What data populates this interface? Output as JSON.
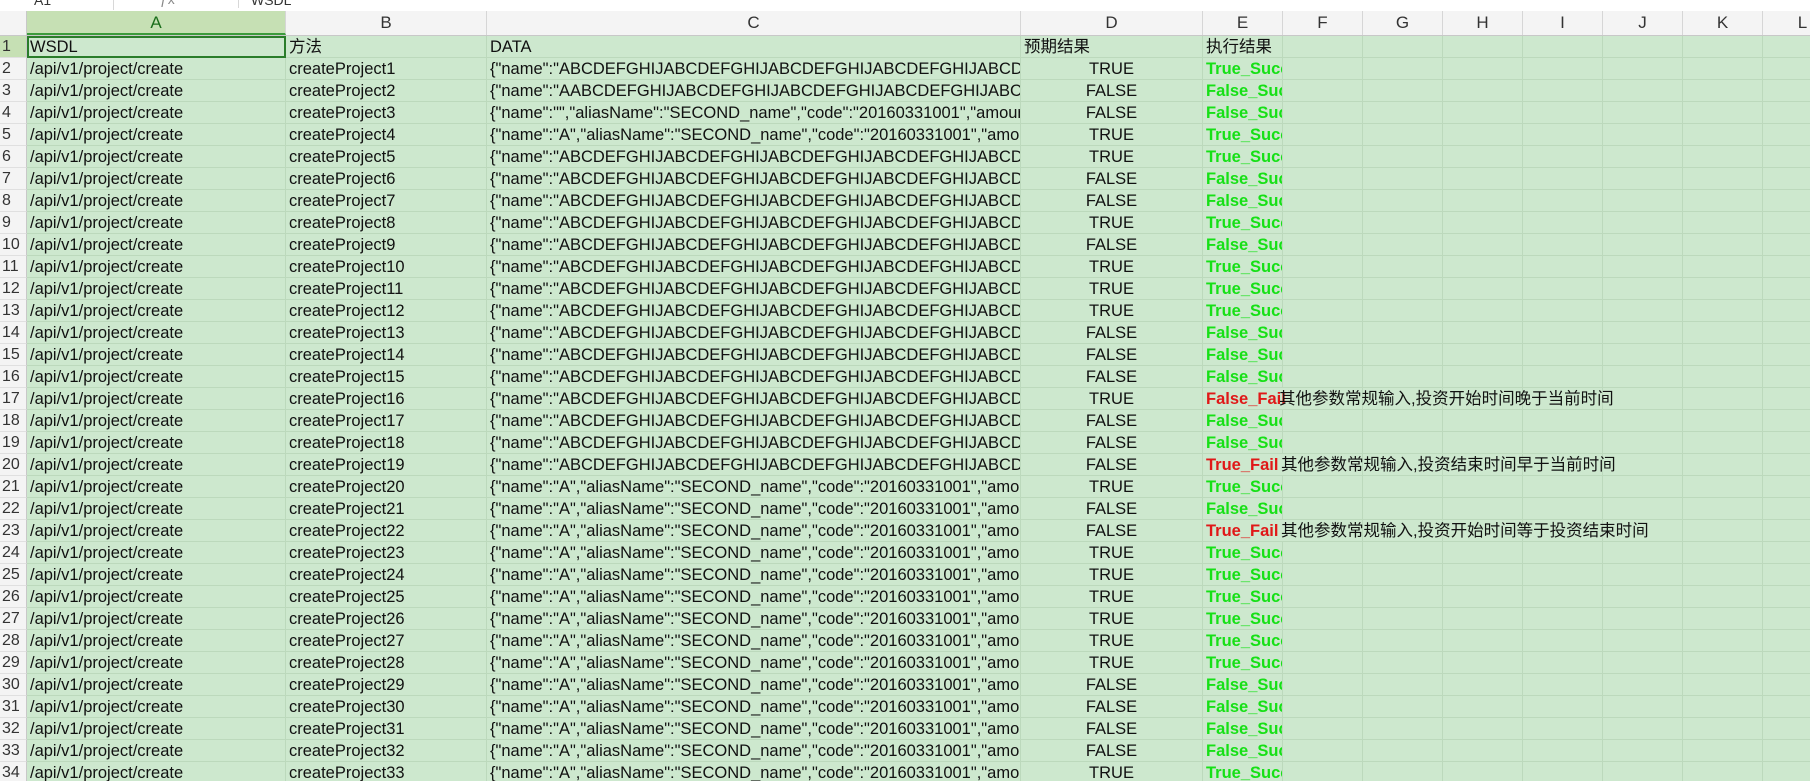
{
  "formula_bar": {
    "name_box": "A1",
    "formula": "WSDL"
  },
  "columns": [
    "A",
    "B",
    "C",
    "D",
    "E",
    "F",
    "G",
    "H",
    "I",
    "J",
    "K",
    "L"
  ],
  "selected_column": "A",
  "rows": [
    {
      "n": "1",
      "a": "WSDL",
      "b": "方法",
      "c": "DATA",
      "d": "预期结果",
      "e": "执行结果",
      "status": "header",
      "note": ""
    },
    {
      "n": "2",
      "a": "/api/v1/project/create",
      "b": "createProject1",
      "c": "{\"name\":\"ABCDEFGHIJABCDEFGHIJABCDEFGHIJABCDEFGHIJABCD",
      "d": "TRUE",
      "e": "True_Success",
      "status": "success",
      "note": ""
    },
    {
      "n": "3",
      "a": "/api/v1/project/create",
      "b": "createProject2",
      "c": "{\"name\":\"AABCDEFGHIJABCDEFGHIJABCDEFGHIJABCDEFGHIJABC",
      "d": "FALSE",
      "e": "False_Success",
      "status": "success",
      "note": ""
    },
    {
      "n": "4",
      "a": "/api/v1/project/create",
      "b": "createProject3",
      "c": "{\"name\":\"\",\"aliasName\":\"SECOND_name\",\"code\":\"20160331001\",\"amoun",
      "d": "FALSE",
      "e": "False_Success",
      "status": "success",
      "note": ""
    },
    {
      "n": "5",
      "a": "/api/v1/project/create",
      "b": "createProject4",
      "c": "{\"name\":\"A\",\"aliasName\":\"SECOND_name\",\"code\":\"20160331001\",\"amou",
      "d": "TRUE",
      "e": "True_Success",
      "status": "success",
      "note": ""
    },
    {
      "n": "6",
      "a": "/api/v1/project/create",
      "b": "createProject5",
      "c": "{\"name\":\"ABCDEFGHIJABCDEFGHIJABCDEFGHIJABCDEFGHIJABCD",
      "d": "TRUE",
      "e": "True_Success",
      "status": "success",
      "note": ""
    },
    {
      "n": "7",
      "a": "/api/v1/project/create",
      "b": "createProject6",
      "c": "{\"name\":\"ABCDEFGHIJABCDEFGHIJABCDEFGHIJABCDEFGHIJABCD",
      "d": "FALSE",
      "e": "False_Success",
      "status": "success",
      "note": ""
    },
    {
      "n": "8",
      "a": "/api/v1/project/create",
      "b": "createProject7",
      "c": "{\"name\":\"ABCDEFGHIJABCDEFGHIJABCDEFGHIJABCDEFGHIJABCD",
      "d": "FALSE",
      "e": "False_Success",
      "status": "success",
      "note": ""
    },
    {
      "n": "9",
      "a": "/api/v1/project/create",
      "b": "createProject8",
      "c": "{\"name\":\"ABCDEFGHIJABCDEFGHIJABCDEFGHIJABCDEFGHIJABCD",
      "d": "TRUE",
      "e": "True_Success",
      "status": "success",
      "note": ""
    },
    {
      "n": "10",
      "a": "/api/v1/project/create",
      "b": "createProject9",
      "c": "{\"name\":\"ABCDEFGHIJABCDEFGHIJABCDEFGHIJABCDEFGHIJABCD",
      "d": "FALSE",
      "e": "False_Success",
      "status": "success",
      "note": ""
    },
    {
      "n": "11",
      "a": "/api/v1/project/create",
      "b": "createProject10",
      "c": "{\"name\":\"ABCDEFGHIJABCDEFGHIJABCDEFGHIJABCDEFGHIJABCD",
      "d": "TRUE",
      "e": "True_Success",
      "status": "success",
      "note": ""
    },
    {
      "n": "12",
      "a": "/api/v1/project/create",
      "b": "createProject11",
      "c": "{\"name\":\"ABCDEFGHIJABCDEFGHIJABCDEFGHIJABCDEFGHIJABCD",
      "d": "TRUE",
      "e": "True_Success",
      "status": "success",
      "note": ""
    },
    {
      "n": "13",
      "a": "/api/v1/project/create",
      "b": "createProject12",
      "c": "{\"name\":\"ABCDEFGHIJABCDEFGHIJABCDEFGHIJABCDEFGHIJABCD",
      "d": "TRUE",
      "e": "True_Success",
      "status": "success",
      "note": ""
    },
    {
      "n": "14",
      "a": "/api/v1/project/create",
      "b": "createProject13",
      "c": "{\"name\":\"ABCDEFGHIJABCDEFGHIJABCDEFGHIJABCDEFGHIJABCD",
      "d": "FALSE",
      "e": "False_Success",
      "status": "success",
      "note": ""
    },
    {
      "n": "15",
      "a": "/api/v1/project/create",
      "b": "createProject14",
      "c": "{\"name\":\"ABCDEFGHIJABCDEFGHIJABCDEFGHIJABCDEFGHIJABCD",
      "d": "FALSE",
      "e": "False_Success",
      "status": "success",
      "note": ""
    },
    {
      "n": "16",
      "a": "/api/v1/project/create",
      "b": "createProject15",
      "c": "{\"name\":\"ABCDEFGHIJABCDEFGHIJABCDEFGHIJABCDEFGHIJABCD",
      "d": "FALSE",
      "e": "False_Success",
      "status": "success",
      "note": ""
    },
    {
      "n": "17",
      "a": "/api/v1/project/create",
      "b": "createProject16",
      "c": "{\"name\":\"ABCDEFGHIJABCDEFGHIJABCDEFGHIJABCDEFGHIJABCD",
      "d": "TRUE",
      "e": "False_Fail",
      "status": "fail",
      "note": "其他参数常规输入,投资开始时间晚于当前时间"
    },
    {
      "n": "18",
      "a": "/api/v1/project/create",
      "b": "createProject17",
      "c": "{\"name\":\"ABCDEFGHIJABCDEFGHIJABCDEFGHIJABCDEFGHIJABCD",
      "d": "FALSE",
      "e": "False_Success",
      "status": "success",
      "note": ""
    },
    {
      "n": "19",
      "a": "/api/v1/project/create",
      "b": "createProject18",
      "c": "{\"name\":\"ABCDEFGHIJABCDEFGHIJABCDEFGHIJABCDEFGHIJABCD",
      "d": "FALSE",
      "e": "False_Success",
      "status": "success",
      "note": ""
    },
    {
      "n": "20",
      "a": "/api/v1/project/create",
      "b": "createProject19",
      "c": "{\"name\":\"ABCDEFGHIJABCDEFGHIJABCDEFGHIJABCDEFGHIJABCD",
      "d": "FALSE",
      "e": "True_Fail",
      "status": "fail",
      "note": "其他参数常规输入,投资结束时间早于当前时间"
    },
    {
      "n": "21",
      "a": "/api/v1/project/create",
      "b": "createProject20",
      "c": "{\"name\":\"A\",\"aliasName\":\"SECOND_name\",\"code\":\"20160331001\",\"amou",
      "d": "TRUE",
      "e": "True_Success",
      "status": "success",
      "note": ""
    },
    {
      "n": "22",
      "a": "/api/v1/project/create",
      "b": "createProject21",
      "c": "{\"name\":\"A\",\"aliasName\":\"SECOND_name\",\"code\":\"20160331001\",\"amou",
      "d": "FALSE",
      "e": "False_Success",
      "status": "success",
      "note": ""
    },
    {
      "n": "23",
      "a": "/api/v1/project/create",
      "b": "createProject22",
      "c": "{\"name\":\"A\",\"aliasName\":\"SECOND_name\",\"code\":\"20160331001\",\"amou",
      "d": "FALSE",
      "e": "True_Fail",
      "status": "fail",
      "note": "其他参数常规输入,投资开始时间等于投资结束时间"
    },
    {
      "n": "24",
      "a": "/api/v1/project/create",
      "b": "createProject23",
      "c": "{\"name\":\"A\",\"aliasName\":\"SECOND_name\",\"code\":\"20160331001\",\"amou",
      "d": "TRUE",
      "e": "True_Success",
      "status": "success",
      "note": ""
    },
    {
      "n": "25",
      "a": "/api/v1/project/create",
      "b": "createProject24",
      "c": "{\"name\":\"A\",\"aliasName\":\"SECOND_name\",\"code\":\"20160331001\",\"amou",
      "d": "TRUE",
      "e": "True_Success",
      "status": "success",
      "note": ""
    },
    {
      "n": "26",
      "a": "/api/v1/project/create",
      "b": "createProject25",
      "c": "{\"name\":\"A\",\"aliasName\":\"SECOND_name\",\"code\":\"20160331001\",\"amou",
      "d": "TRUE",
      "e": "True_Success",
      "status": "success",
      "note": ""
    },
    {
      "n": "27",
      "a": "/api/v1/project/create",
      "b": "createProject26",
      "c": "{\"name\":\"A\",\"aliasName\":\"SECOND_name\",\"code\":\"20160331001\",\"amou",
      "d": "TRUE",
      "e": "True_Success",
      "status": "success",
      "note": ""
    },
    {
      "n": "28",
      "a": "/api/v1/project/create",
      "b": "createProject27",
      "c": "{\"name\":\"A\",\"aliasName\":\"SECOND_name\",\"code\":\"20160331001\",\"amou",
      "d": "TRUE",
      "e": "True_Success",
      "status": "success",
      "note": ""
    },
    {
      "n": "29",
      "a": "/api/v1/project/create",
      "b": "createProject28",
      "c": "{\"name\":\"A\",\"aliasName\":\"SECOND_name\",\"code\":\"20160331001\",\"amou",
      "d": "TRUE",
      "e": "True_Success",
      "status": "success",
      "note": ""
    },
    {
      "n": "30",
      "a": "/api/v1/project/create",
      "b": "createProject29",
      "c": "{\"name\":\"A\",\"aliasName\":\"SECOND_name\",\"code\":\"20160331001\",\"amou",
      "d": "FALSE",
      "e": "False_Success",
      "status": "success",
      "note": ""
    },
    {
      "n": "31",
      "a": "/api/v1/project/create",
      "b": "createProject30",
      "c": "{\"name\":\"A\",\"aliasName\":\"SECOND_name\",\"code\":\"20160331001\",\"amou",
      "d": "FALSE",
      "e": "False_Success",
      "status": "success",
      "note": ""
    },
    {
      "n": "32",
      "a": "/api/v1/project/create",
      "b": "createProject31",
      "c": "{\"name\":\"A\",\"aliasName\":\"SECOND_name\",\"code\":\"20160331001\",\"amou",
      "d": "FALSE",
      "e": "False_Success",
      "status": "success",
      "note": ""
    },
    {
      "n": "33",
      "a": "/api/v1/project/create",
      "b": "createProject32",
      "c": "{\"name\":\"A\",\"aliasName\":\"SECOND_name\",\"code\":\"20160331001\",\"amou",
      "d": "FALSE",
      "e": "False_Success",
      "status": "success",
      "note": ""
    },
    {
      "n": "34",
      "a": "/api/v1/project/create",
      "b": "createProject33",
      "c": "{\"name\":\"A\",\"aliasName\":\"SECOND_name\",\"code\":\"20160331001\",\"amou",
      "d": "TRUE",
      "e": "True_Success",
      "status": "success",
      "note": ""
    }
  ],
  "colors": {
    "cell_bg": "#cde8ce",
    "success": "#16e016",
    "fail": "#e01818",
    "selected_header": "#c6e0b4"
  }
}
